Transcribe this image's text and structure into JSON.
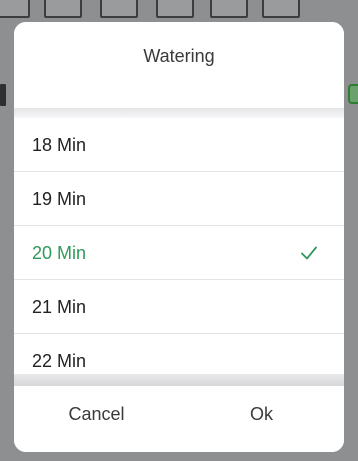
{
  "dialog": {
    "title": "Watering",
    "options": [
      {
        "label": "18 Min",
        "selected": false
      },
      {
        "label": "19 Min",
        "selected": false
      },
      {
        "label": "20 Min",
        "selected": true
      },
      {
        "label": "21 Min",
        "selected": false
      },
      {
        "label": "22 Min",
        "selected": false
      }
    ],
    "cancel_label": "Cancel",
    "ok_label": "Ok"
  },
  "colors": {
    "selected": "#2e9a5a",
    "text": "#222222",
    "overlay": "#8e8f91"
  },
  "icons": {
    "selected_marker": "checkmark-icon"
  }
}
